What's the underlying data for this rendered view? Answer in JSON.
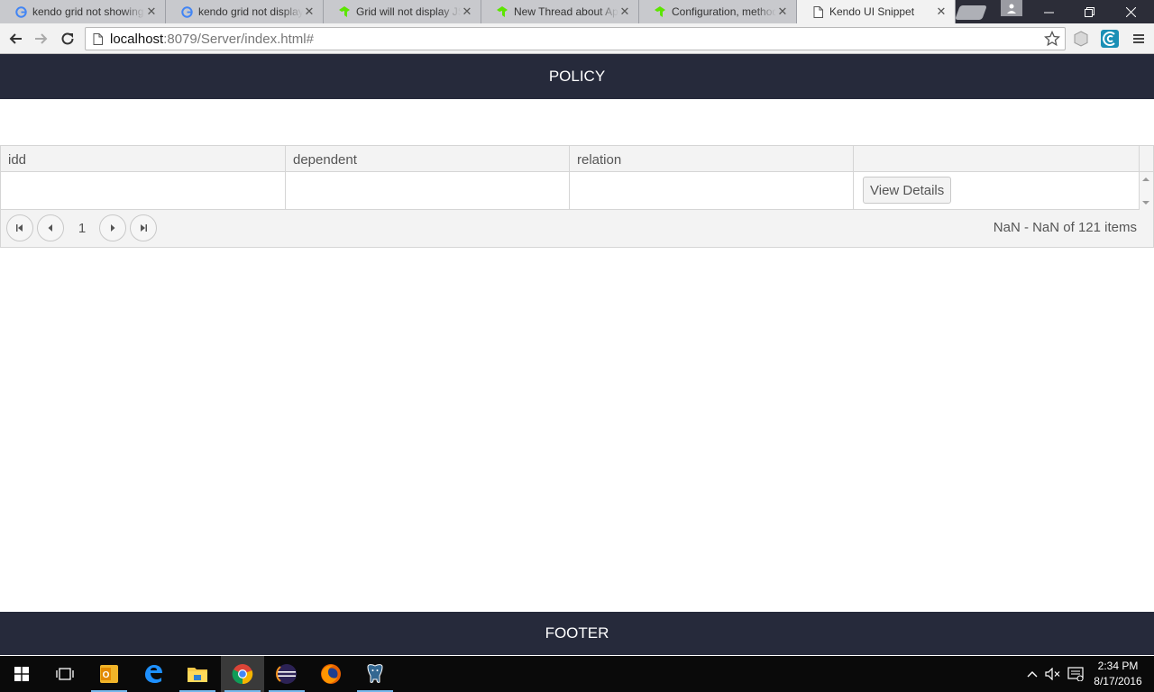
{
  "browser": {
    "tabs": [
      {
        "title": "kendo grid not showing",
        "favicon": "google-icon",
        "active": false
      },
      {
        "title": "kendo grid not display",
        "favicon": "google-icon",
        "active": false
      },
      {
        "title": "Grid will not display JSON",
        "favicon": "telerik-icon",
        "active": false
      },
      {
        "title": "New Thread about App",
        "favicon": "telerik-icon",
        "active": false
      },
      {
        "title": "Configuration, methods",
        "favicon": "telerik-icon",
        "active": false
      },
      {
        "title": "Kendo UI Snippet",
        "favicon": "page-icon",
        "active": true
      }
    ],
    "address": {
      "host": "localhost",
      "path": ":8079/Server/index.html#"
    }
  },
  "page": {
    "header_title": "POLICY",
    "footer_title": "FOOTER"
  },
  "grid": {
    "columns": [
      "idd",
      "dependent",
      "relation",
      ""
    ],
    "rows": [
      {
        "idd": "",
        "dependent": "",
        "relation": "",
        "action_label": "View Details"
      }
    ],
    "pager": {
      "current_page": "1",
      "info": "NaN - NaN of 121 items"
    }
  },
  "taskbar": {
    "clock_time": "2:34 PM",
    "clock_date": "8/17/2016"
  },
  "colors": {
    "header_bg": "#262a3b",
    "footer_bg": "#262a3b",
    "grid_header_bg": "#f3f3f3"
  }
}
